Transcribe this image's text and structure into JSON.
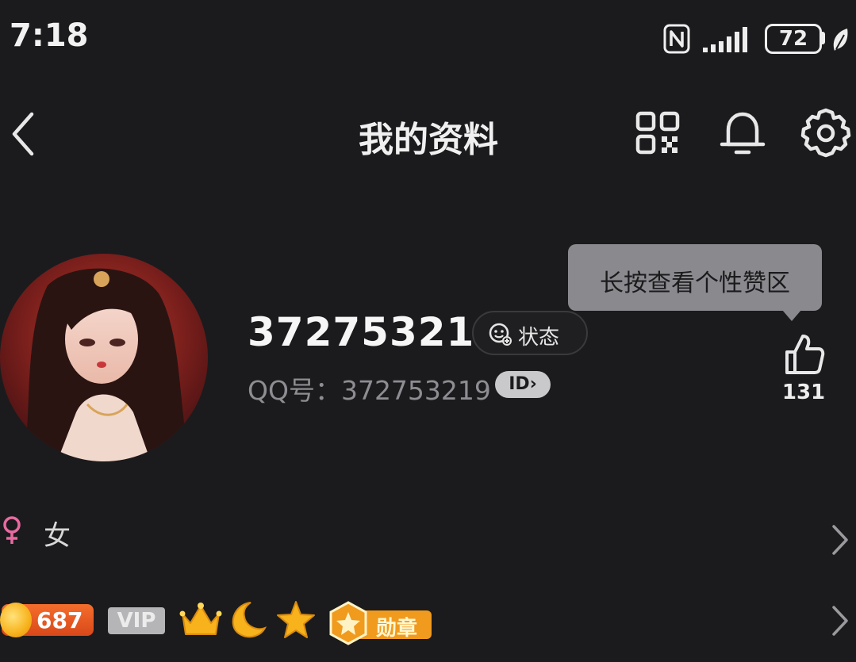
{
  "status_bar": {
    "time": "7:18",
    "battery": "72",
    "icons": [
      "nfc-icon",
      "signal-icon",
      "battery-icon",
      "leaf-icon"
    ]
  },
  "header": {
    "title": "我的资料",
    "icons": [
      "back-icon",
      "qr-code-icon",
      "bell-icon",
      "gear-icon"
    ]
  },
  "profile": {
    "nickname": "372753219",
    "status_label": "状态",
    "qq_label": "QQ号：372753219",
    "id_badge": "ID",
    "gender": "女"
  },
  "tooltip": {
    "text": "长按查看个性赞区"
  },
  "like": {
    "count": "131"
  },
  "badges": {
    "coin_value": "687",
    "vip_label": "VIP",
    "medal_label": "勋章",
    "icons": [
      "crown-icon",
      "moon-icon",
      "star-icon",
      "medal-icon"
    ]
  },
  "colors": {
    "background": "#1b1b1d",
    "gender_female": "#e86aa0",
    "coin_orange": "#e8562a",
    "medal_orange": "#f09a1e",
    "gold": "#f7b21c"
  }
}
